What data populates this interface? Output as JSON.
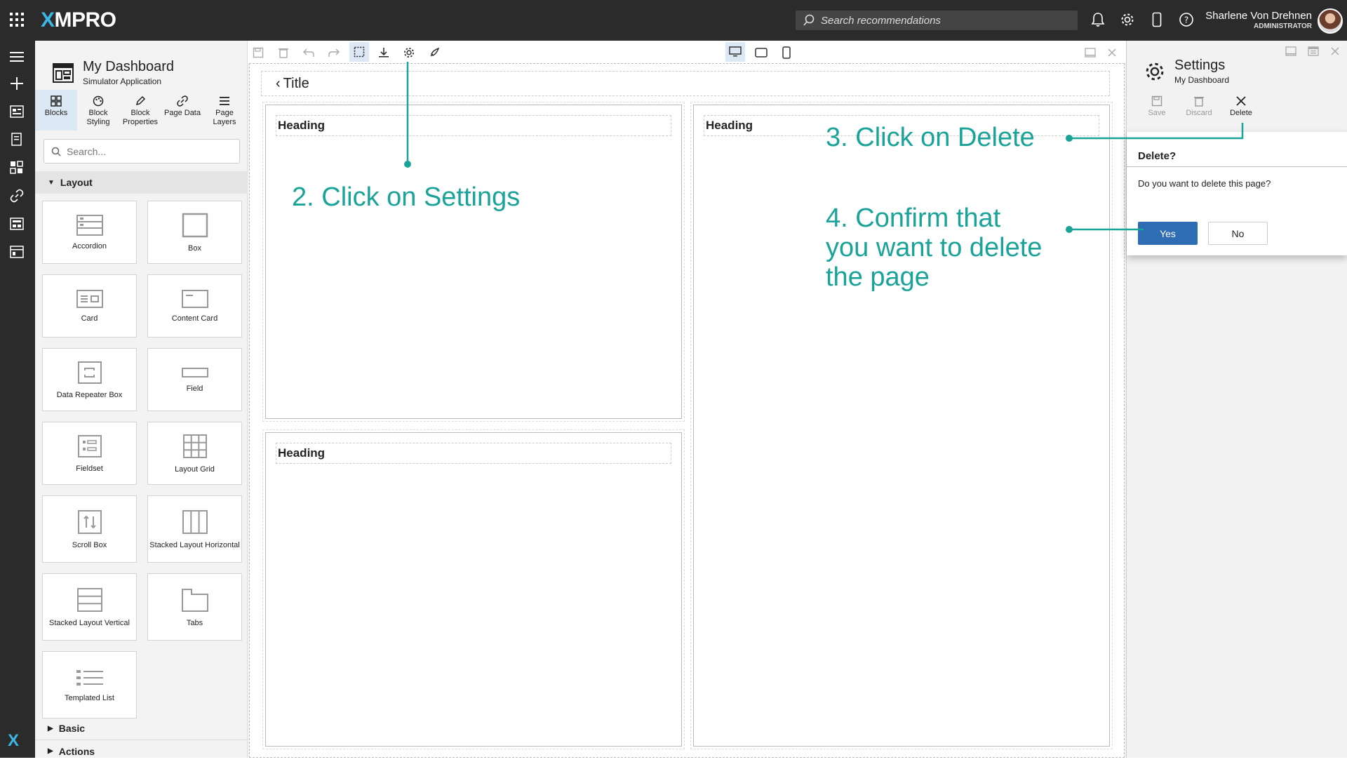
{
  "topbar": {
    "brand_x": "X",
    "brand_rest": "MPRO",
    "search_placeholder": "Search recommendations",
    "user_name": "Sharlene Von Drehnen",
    "user_role": "ADMINISTRATOR"
  },
  "blocks_panel": {
    "title": "My Dashboard",
    "subtitle": "Simulator Application",
    "tabs": [
      {
        "label": "Blocks"
      },
      {
        "label": "Block Styling"
      },
      {
        "label": "Block Properties"
      },
      {
        "label": "Page Data"
      },
      {
        "label": "Page Layers"
      }
    ],
    "search_placeholder": "Search...",
    "categories": {
      "layout": "Layout",
      "basic": "Basic",
      "actions": "Actions"
    },
    "blocks": [
      {
        "label": "Accordion",
        "icon": "accordion-icon"
      },
      {
        "label": "Box",
        "icon": "box-icon"
      },
      {
        "label": "Card",
        "icon": "card-icon"
      },
      {
        "label": "Content Card",
        "icon": "content-card-icon"
      },
      {
        "label": "Data Repeater Box",
        "icon": "data-repeater-icon"
      },
      {
        "label": "Field",
        "icon": "field-icon"
      },
      {
        "label": "Fieldset",
        "icon": "fieldset-icon"
      },
      {
        "label": "Layout Grid",
        "icon": "layout-grid-icon"
      },
      {
        "label": "Scroll Box",
        "icon": "scroll-box-icon"
      },
      {
        "label": "Stacked Layout Horizontal",
        "icon": "stacked-horizontal-icon"
      },
      {
        "label": "Stacked Layout Vertical",
        "icon": "stacked-vertical-icon"
      },
      {
        "label": "Tabs",
        "icon": "tabs-icon"
      },
      {
        "label": "Templated List",
        "icon": "templated-list-icon"
      }
    ]
  },
  "canvas": {
    "page_title": "Title",
    "headings": [
      "Heading",
      "Heading",
      "Heading"
    ]
  },
  "settings": {
    "title": "Settings",
    "subtitle": "My Dashboard",
    "actions": {
      "save": "Save",
      "discard": "Discard",
      "delete": "Delete"
    }
  },
  "dialog": {
    "title": "Delete?",
    "message": "Do you want to delete this page?",
    "yes": "Yes",
    "no": "No"
  },
  "annotations": {
    "step2": "2. Click on Settings",
    "step3": "3. Click on Delete",
    "step4_line1": "4. Confirm that",
    "step4_line2": "you want to delete",
    "step4_line3": "the page"
  },
  "colors": {
    "annotation": "#1aa398",
    "primary_button": "#2e6db3",
    "topbar": "#2b2b2b",
    "active_tab": "#dce8f3"
  }
}
